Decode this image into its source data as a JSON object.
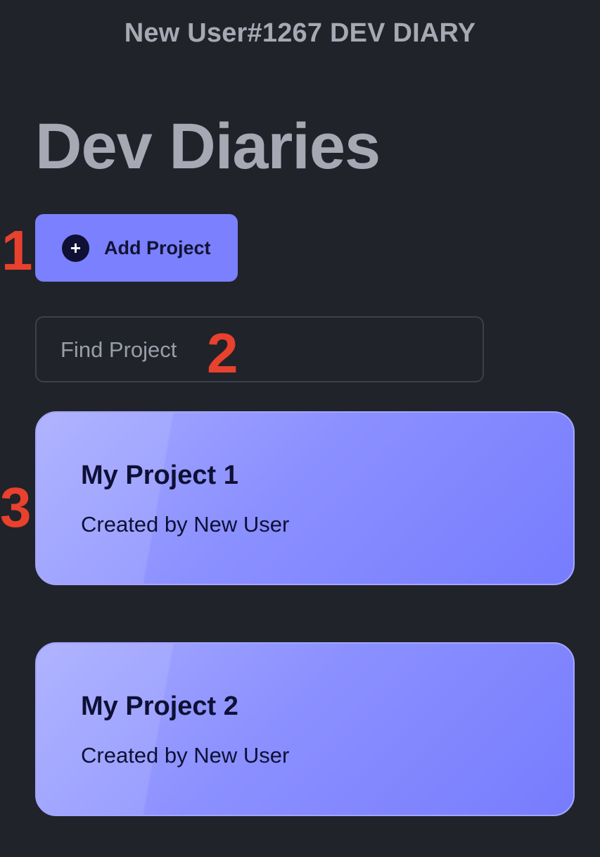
{
  "header": {
    "app_title": "New User#1267 DEV DIARY",
    "page_title": "Dev Diaries"
  },
  "actions": {
    "add_project_label": "Add Project",
    "add_project_icon": "plus-circle-icon"
  },
  "search": {
    "placeholder": "Find Project",
    "value": ""
  },
  "projects": [
    {
      "title": "My Project 1",
      "subtitle": "Created by New User"
    },
    {
      "title": "My Project 2",
      "subtitle": "Created by New User"
    }
  ],
  "annotations": [
    "1",
    "2",
    "3"
  ],
  "colors": {
    "background": "#20232a",
    "accent": "#7b80fe",
    "card_gradient_start": "#a7abff",
    "card_gradient_end": "#777cfe",
    "heading_text": "#a6a9b3",
    "annotation": "#e8412d"
  }
}
